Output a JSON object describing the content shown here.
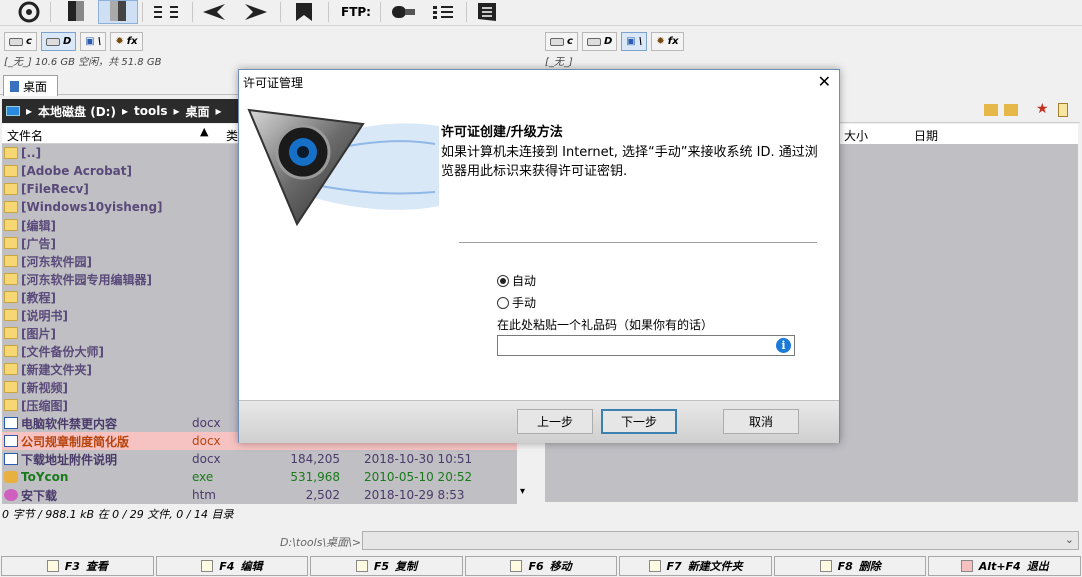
{
  "toolbar": {
    "ftp_label": "FTP:"
  },
  "drives_left": [
    {
      "letter": "c",
      "selected": false
    },
    {
      "letter": "D",
      "selected": true
    },
    {
      "letter": "\\",
      "selected": false
    },
    {
      "letter": "fx",
      "selected": false
    }
  ],
  "drives_right": [
    {
      "letter": "c",
      "selected": false
    },
    {
      "letter": "D",
      "selected": false
    },
    {
      "letter": "\\",
      "selected": true
    },
    {
      "letter": "fx",
      "selected": false
    }
  ],
  "left_info": "[_无_] 10.6 GB 空闲，共 51.8 GB",
  "right_info": "[_无_]",
  "tab_label": "桌面",
  "path": {
    "computer": "本地磁盘 (D:)",
    "folder": "tools",
    "subfolder": "桌面"
  },
  "columns": {
    "name": "文件名",
    "type": "类",
    "size": "大小",
    "date": "日期"
  },
  "files": [
    {
      "name": "[..]",
      "ext": "",
      "size": "",
      "date": "",
      "kind": "up"
    },
    {
      "name": "[Adobe Acrobat]",
      "ext": "",
      "size": "",
      "date": "",
      "kind": "folder"
    },
    {
      "name": "[FileRecv]",
      "ext": "",
      "size": "",
      "date": "",
      "kind": "folder"
    },
    {
      "name": "[Windows10yisheng]",
      "ext": "",
      "size": "",
      "date": "",
      "kind": "folder"
    },
    {
      "name": "[编辑]",
      "ext": "",
      "size": "",
      "date": "",
      "kind": "folder"
    },
    {
      "name": "[广告]",
      "ext": "",
      "size": "",
      "date": "",
      "kind": "folder"
    },
    {
      "name": "[河东软件园]",
      "ext": "",
      "size": "",
      "date": "",
      "kind": "folder"
    },
    {
      "name": "[河东软件园专用编辑器]",
      "ext": "",
      "size": "",
      "date": "",
      "kind": "folder"
    },
    {
      "name": "[教程]",
      "ext": "",
      "size": "",
      "date": "",
      "kind": "folder"
    },
    {
      "name": "[说明书]",
      "ext": "",
      "size": "",
      "date": "",
      "kind": "folder"
    },
    {
      "name": "[图片]",
      "ext": "",
      "size": "",
      "date": "",
      "kind": "folder"
    },
    {
      "name": "[文件备份大师]",
      "ext": "",
      "size": "",
      "date": "",
      "kind": "folder"
    },
    {
      "name": "[新建文件夹]",
      "ext": "",
      "size": "",
      "date": "",
      "kind": "folder"
    },
    {
      "name": "[新视频]",
      "ext": "",
      "size": "",
      "date": "",
      "kind": "folder"
    },
    {
      "name": "[压缩图]",
      "ext": "",
      "size": "",
      "date": "",
      "kind": "folder"
    },
    {
      "name": "电脑软件禁更内容",
      "ext": "docx",
      "size": "",
      "date": "",
      "kind": "doc"
    },
    {
      "name": "公司规章制度简化版",
      "ext": "docx",
      "size": "",
      "date": "",
      "kind": "doc",
      "highlight": true
    },
    {
      "name": "下载地址附件说明",
      "ext": "docx",
      "size": "184,205",
      "date": "2018-10-30 10:51",
      "kind": "doc"
    },
    {
      "name": "ToYcon",
      "ext": "exe",
      "size": "531,968",
      "date": "2010-05-10 20:52",
      "kind": "exe"
    },
    {
      "name": "安下载",
      "ext": "htm",
      "size": "2,502",
      "date": "2018-10-29 8:53",
      "kind": "htm"
    }
  ],
  "status": "0 字节 / 988.1 kB 在 0 / 29 文件, 0 / 14 目录",
  "cmd_path": "D:\\tools\\桌面\\>",
  "fkeys": [
    {
      "key": "F3",
      "label": "查看"
    },
    {
      "key": "F4",
      "label": "编辑"
    },
    {
      "key": "F5",
      "label": "复制"
    },
    {
      "key": "F6",
      "label": "移动"
    },
    {
      "key": "F7",
      "label": "新建文件夹"
    },
    {
      "key": "F8",
      "label": "删除"
    },
    {
      "key": "Alt+F4",
      "label": "退出"
    }
  ],
  "dialog": {
    "title": "许可证管理",
    "heading": "许可证创建/升级方法",
    "description": "如果计算机未连接到 Internet, 选择“手动”来接收系统 ID. 通过浏览器用此标识来获得许可证密钥.",
    "option_auto": "自动",
    "option_manual": "手动",
    "selected": "auto",
    "gift_label": "在此处粘贴一个礼品码（如果你有的话）",
    "gift_value": "",
    "back": "上一步",
    "next": "下一步",
    "cancel": "取消"
  }
}
